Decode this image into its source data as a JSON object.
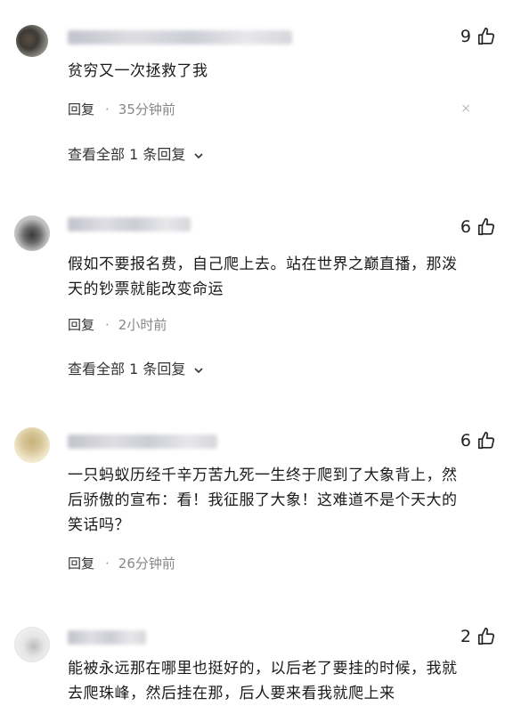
{
  "comments": [
    {
      "likes": "9",
      "text": "贫穷又一次拯救了我",
      "reply_label": "回复",
      "separator": "·",
      "time": "35分钟前",
      "dismiss_icon": "×",
      "view_all": "查看全部 1 条回复"
    },
    {
      "likes": "6",
      "text": "假如不要报名费，自己爬上去。站在世界之巅直播，那泼天的钞票就能改变命运",
      "reply_label": "回复",
      "separator": "·",
      "time": "2小时前",
      "view_all": "查看全部 1 条回复"
    },
    {
      "likes": "6",
      "text": "一只蚂蚁历经千辛万苦九死一生终于爬到了大象背上，然后骄傲的宣布：看！我征服了大象！这难道不是个天大的笑话吗？",
      "reply_label": "回复",
      "separator": "·",
      "time": "26分钟前"
    },
    {
      "likes": "2",
      "text": "能被永远那在哪里也挺好的，以后老了要挂的时候，我就去爬珠峰，然后挂在那，后人要来看我就爬上来"
    }
  ],
  "icons": {
    "like": "thumbs-up-icon",
    "chevron": "chevron-down-icon",
    "dismiss": "close-icon"
  },
  "colors": {
    "text": "#1a1a1a",
    "meta": "#888888",
    "background": "#ffffff"
  }
}
